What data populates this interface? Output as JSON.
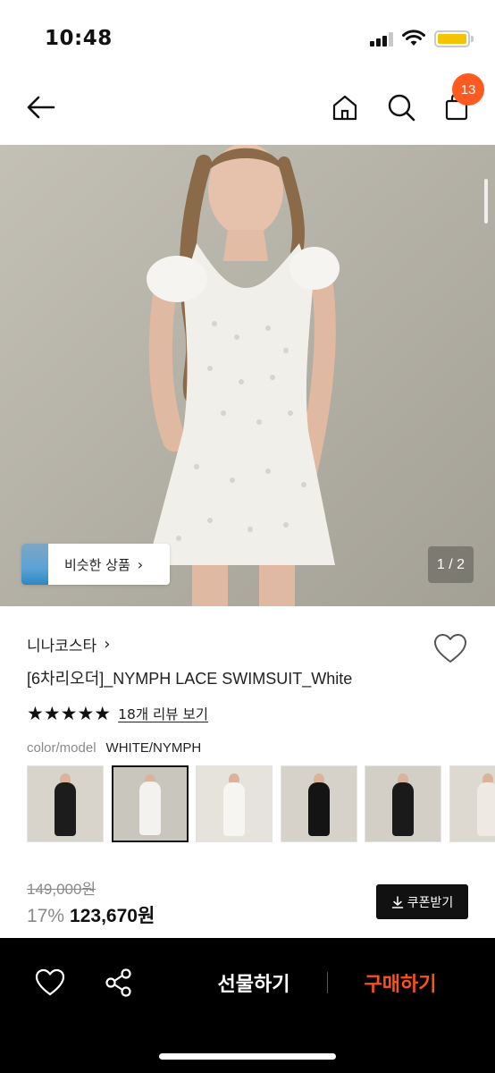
{
  "status_bar": {
    "time": "10:48",
    "signal_icon": "cellular-signal-icon",
    "wifi_icon": "wifi-icon",
    "battery_icon": "battery-icon",
    "battery_color": "#f5c400"
  },
  "nav": {
    "back_icon": "arrow-left-icon",
    "home_icon": "home-icon",
    "search_icon": "search-icon",
    "cart_icon": "shopping-bag-icon",
    "cart_count": "13",
    "badge_color": "#ff5a1f"
  },
  "hero": {
    "similar_label": "비슷한 상품",
    "similar_chevron": "›",
    "page_indicator": "1 / 2"
  },
  "product": {
    "brand": "니나코스타",
    "brand_chevron": "›",
    "title": "[6차리오더]_NYMPH LACE SWIMSUIT_White",
    "stars": "★★★★★",
    "rating_stars": 5,
    "review_link": "18개 리뷰 보기",
    "option_label": "color/model",
    "option_value": "WHITE/NYMPH",
    "original_price": "149,000원",
    "discount": "17%",
    "sale_price": "123,670원",
    "coupon_label": "쿠폰받기",
    "coupon_icon": "download-icon"
  },
  "thumbnails": [
    {
      "name": "thumb-1",
      "dress": "#1c1c1c",
      "bg": "#d8d4cc"
    },
    {
      "name": "thumb-2",
      "dress": "#f4f2ee",
      "bg": "#c9c6bd",
      "selected": true
    },
    {
      "name": "thumb-3",
      "dress": "#f7f5f1",
      "bg": "#e6e2dc"
    },
    {
      "name": "thumb-4",
      "dress": "#141414",
      "bg": "#d6d2c9"
    },
    {
      "name": "thumb-5",
      "dress": "#1a1a1a",
      "bg": "#d3cfc6"
    },
    {
      "name": "thumb-6",
      "dress": "#eeeae3",
      "bg": "#ddd9d1"
    }
  ],
  "bottom_bar": {
    "like_icon": "heart-outline-icon",
    "share_icon": "share-icon",
    "gift_label": "선물하기",
    "buy_label": "구매하기",
    "buy_color": "#ff4f1a"
  }
}
